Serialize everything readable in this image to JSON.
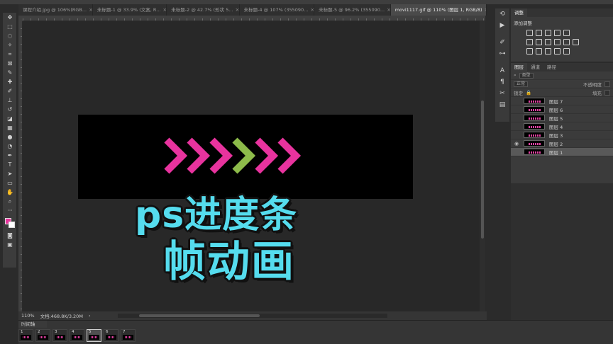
{
  "tabs": [
    {
      "label": "课程介绍.jpg @ 106%(RGB...",
      "active": false
    },
    {
      "label": "未标题-1 @ 33.9% (文案, R...",
      "active": false
    },
    {
      "label": "未标题-2 @ 42.7% (形状 5...",
      "active": false
    },
    {
      "label": "未标题-4 @ 107% (355090...",
      "active": false
    },
    {
      "label": "未标题-5 @ 96.2% (355090...",
      "active": false
    },
    {
      "label": "movi1117.gif @ 110% (图层 1, RGB/8)",
      "active": true
    }
  ],
  "canvas": {
    "title_line1": "ps进度条",
    "title_line2": "帧动画",
    "arrow_colors": [
      "#e8339e",
      "#e8339e",
      "#e8339e",
      "#8dbb4a",
      "#e8339e",
      "#e8339e"
    ]
  },
  "status": {
    "zoom": "110%",
    "doc": "文档:468.8K/3.20M"
  },
  "timeline": {
    "title": "时间轴",
    "frames": [
      {
        "num": "1",
        "selected": false
      },
      {
        "num": "2",
        "selected": false
      },
      {
        "num": "3",
        "selected": false
      },
      {
        "num": "4",
        "selected": false
      },
      {
        "num": "5",
        "selected": true
      },
      {
        "num": "6",
        "selected": false
      },
      {
        "num": "7",
        "selected": false
      }
    ]
  },
  "adjust_panel": {
    "tab": "调整",
    "subtitle": "添加调整"
  },
  "layers_panel": {
    "tabs": [
      "图层",
      "通道",
      "路径"
    ],
    "filter": "类型",
    "blend": "正常",
    "opacity_label": "不透明度",
    "lock_label": "锁定",
    "fill_label": "填充",
    "layers": [
      {
        "name": "图层 7",
        "visible": false,
        "selected": false
      },
      {
        "name": "图层 6",
        "visible": false,
        "selected": false
      },
      {
        "name": "图层 5",
        "visible": false,
        "selected": false
      },
      {
        "name": "图层 4",
        "visible": false,
        "selected": false
      },
      {
        "name": "图层 3",
        "visible": false,
        "selected": false
      },
      {
        "name": "图层 2",
        "visible": true,
        "selected": false
      },
      {
        "name": "图层 1",
        "visible": false,
        "selected": true
      }
    ]
  },
  "colors": {
    "foreground": "#e8339e",
    "background": "#ffffff",
    "title_text": "#55dcee",
    "accent_arrow": "#8dbb4a"
  }
}
